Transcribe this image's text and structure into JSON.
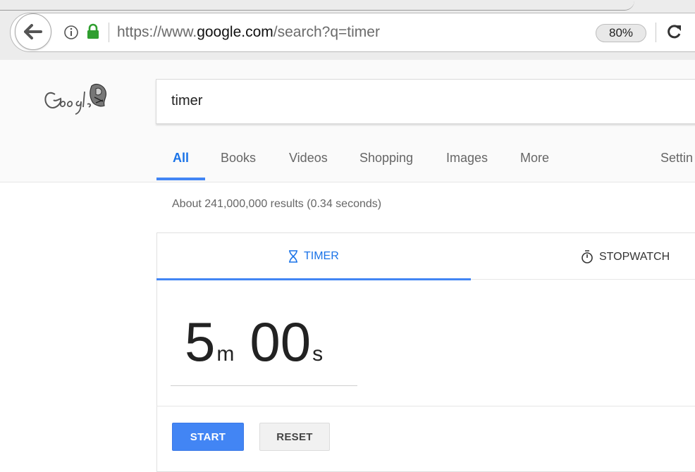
{
  "browser": {
    "url_prefix": "https://www.",
    "url_domain": "google.com",
    "url_path": "/search?q=timer",
    "zoom": "80%"
  },
  "search": {
    "query": "timer"
  },
  "nav": {
    "tabs": [
      {
        "label": "All",
        "active": true
      },
      {
        "label": "Books"
      },
      {
        "label": "Videos"
      },
      {
        "label": "Shopping"
      },
      {
        "label": "Images"
      },
      {
        "label": "More"
      }
    ],
    "settings_label": "Settin"
  },
  "results": {
    "stats": "About 241,000,000 results (0.34 seconds)"
  },
  "timer_card": {
    "tab_timer": "TIMER",
    "tab_stopwatch": "STOPWATCH",
    "minutes": "5",
    "minutes_unit": "m",
    "seconds": "00",
    "seconds_unit": "s",
    "start_label": "START",
    "reset_label": "RESET"
  },
  "colors": {
    "accent": "#4285f4",
    "lock": "#2f9e2f"
  }
}
